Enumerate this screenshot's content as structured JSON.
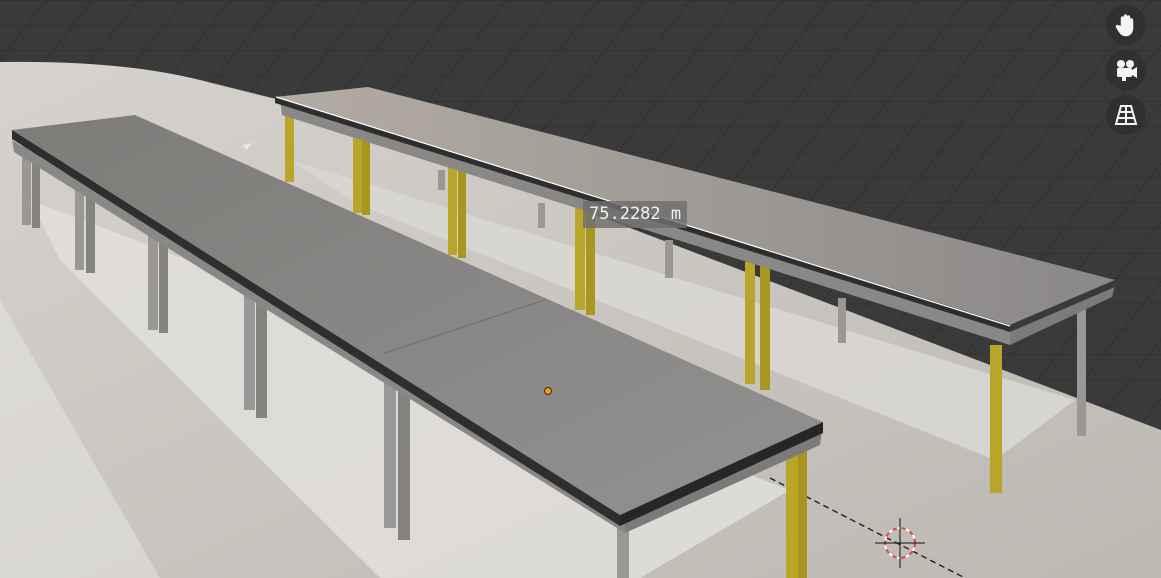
{
  "viewport": {
    "measurement_label": "75.2282 m"
  },
  "navigation_gizmo": {
    "buttons": [
      {
        "name": "pan-view",
        "icon": "hand-icon"
      },
      {
        "name": "camera-view",
        "icon": "camera-icon"
      },
      {
        "name": "perspective-toggle",
        "icon": "grid-perspective-icon"
      }
    ]
  },
  "colors": {
    "grid_background": "#3a3a3a",
    "floor": "#c9c5bf",
    "tabletop": "#8e8c89",
    "tabletop_edge": "#2e2e2e",
    "leg_gray": "#9a9896",
    "leg_yellow": "#b8a52a",
    "shelf": "#d8d6d3"
  }
}
